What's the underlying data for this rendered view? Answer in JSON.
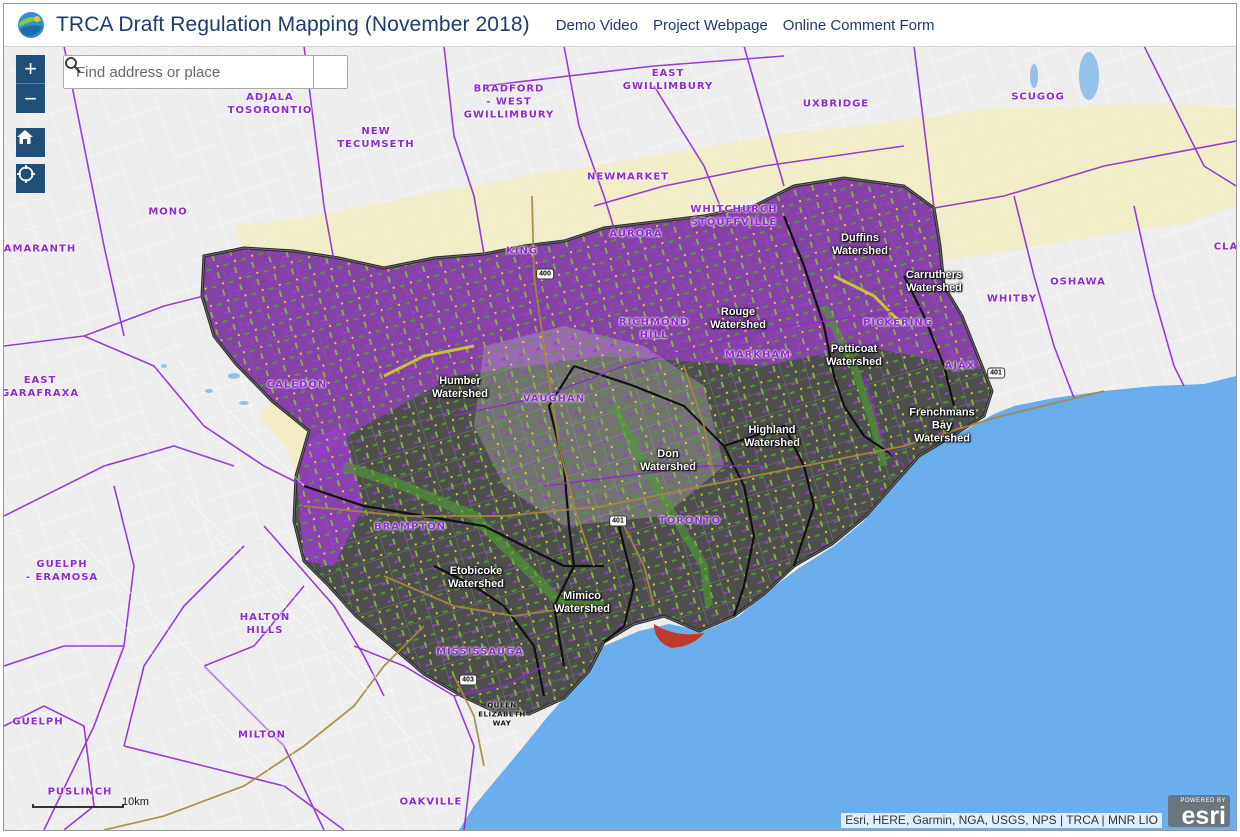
{
  "header": {
    "title": "TRCA Draft Regulation Mapping (November 2018)",
    "links": [
      "Demo Video",
      "Project Webpage",
      "Online Comment Form"
    ]
  },
  "search": {
    "placeholder": "Find address or place"
  },
  "controls": {
    "zoom_in": "+",
    "zoom_out": "−"
  },
  "places": [
    "ADJALA\nTOSORONTIO",
    "BRADFORD\n- WEST\nGWILLIMBURY",
    "EAST\nGWILLIMBURY",
    "UXBRIDGE",
    "SCUGOG",
    "NEW\nTECUMSETH",
    "MONO",
    "NEWMARKET",
    "AURORA",
    "WHITCHURCH\nSTOUFFVILLE",
    "KING",
    "AMARANTH",
    "CLA",
    "OSHAWA",
    "WHITBY",
    "PICKERING",
    "AJAX",
    "MARKHAM",
    "RICHMOND\nHILL",
    "VAUGHAN",
    "CALEDON",
    "EAST\nGARAFRAXA",
    "BRAMPTON",
    "TORONTO",
    "GUELPH\n- ERAMOSA",
    "HALTON\nHILLS",
    "MISSISSAUGA",
    "MILTON",
    "GUELPH",
    "PUSLINCH",
    "OAKVILLE"
  ],
  "watersheds": [
    "Duffins\nWatershed",
    "Carruthers\nWatershed",
    "Rouge\nWatershed",
    "Petticoat\nWatershed",
    "Humber\nWatershed",
    "Frenchmans\nBay\nWatershed",
    "Highland\nWatershed",
    "Don\nWatershed",
    "Etobicoke\nWatershed",
    "Mimico\nWatershed"
  ],
  "highway_shields": [
    "400",
    "401",
    "401",
    "403",
    "QUEEN\nELIZABETH\nWAY"
  ],
  "scalebar": {
    "label": "10km"
  },
  "attribution": "Esri, HERE, Garmin, NGA, USGS, NPS | TRCA | MNR LIO",
  "esri_badge": {
    "powered": "POWERED BY",
    "word": "esri"
  },
  "colors": {
    "header_text": "#1f3a6e",
    "control_bg": "#1f4e79",
    "lake": "#6aaeee",
    "municipal_boundary": "#8e2bd0",
    "watershed_region": "#4e4e4e",
    "regulated_area": "#9a3dc9",
    "vegetation": "#4f9e2e",
    "greenbelt": "#f1ecc3"
  }
}
